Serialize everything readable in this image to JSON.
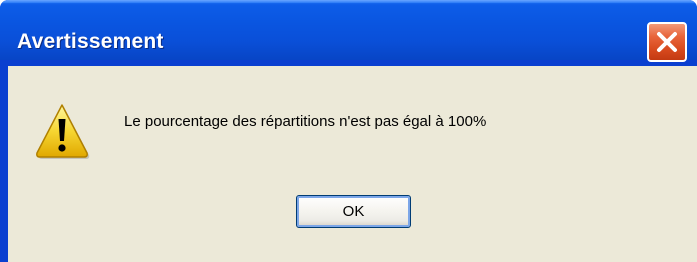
{
  "window": {
    "title": "Avertissement",
    "close_icon": "close-icon"
  },
  "dialog": {
    "icon": "warning-icon",
    "message": "Le pourcentage des répartitions n'est pas égal à 100%",
    "ok_label": "OK"
  },
  "colors": {
    "titlebar": "#0a55e0",
    "close_button": "#e8643a",
    "client_background": "#ece9d8",
    "warning_yellow": "#f6d632"
  }
}
